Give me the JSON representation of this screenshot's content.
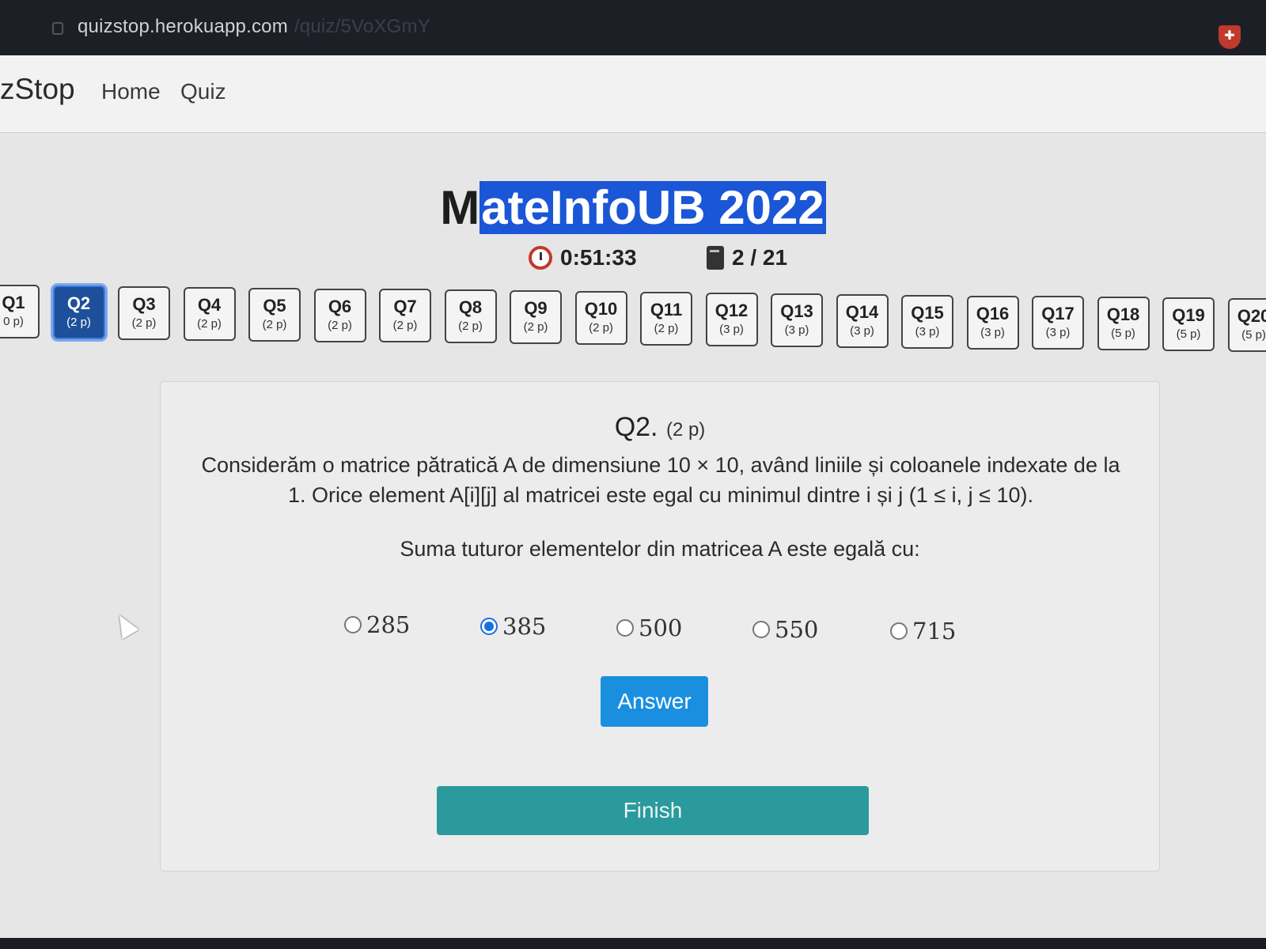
{
  "browser": {
    "url_host": "quizstop.herokuapp.com",
    "url_path": "/quiz/5VoXGmY"
  },
  "navbar": {
    "brand": "zStop",
    "links": [
      "Home",
      "Quiz"
    ]
  },
  "quiz": {
    "title_first": "M",
    "title_highlighted": "ateInfoUB 2022",
    "timer": "0:51:33",
    "progress": "2 / 21"
  },
  "question_nav": [
    {
      "label": "Q1",
      "points": "0 p)",
      "active": false
    },
    {
      "label": "Q2",
      "points": "(2 p)",
      "active": true
    },
    {
      "label": "Q3",
      "points": "(2 p)",
      "active": false
    },
    {
      "label": "Q4",
      "points": "(2 p)",
      "active": false
    },
    {
      "label": "Q5",
      "points": "(2 p)",
      "active": false
    },
    {
      "label": "Q6",
      "points": "(2 p)",
      "active": false
    },
    {
      "label": "Q7",
      "points": "(2 p)",
      "active": false
    },
    {
      "label": "Q8",
      "points": "(2 p)",
      "active": false
    },
    {
      "label": "Q9",
      "points": "(2 p)",
      "active": false
    },
    {
      "label": "Q10",
      "points": "(2 p)",
      "active": false
    },
    {
      "label": "Q11",
      "points": "(2 p)",
      "active": false
    },
    {
      "label": "Q12",
      "points": "(3 p)",
      "active": false
    },
    {
      "label": "Q13",
      "points": "(3 p)",
      "active": false
    },
    {
      "label": "Q14",
      "points": "(3 p)",
      "active": false
    },
    {
      "label": "Q15",
      "points": "(3 p)",
      "active": false
    },
    {
      "label": "Q16",
      "points": "(3 p)",
      "active": false
    },
    {
      "label": "Q17",
      "points": "(3 p)",
      "active": false
    },
    {
      "label": "Q18",
      "points": "(5 p)",
      "active": false
    },
    {
      "label": "Q19",
      "points": "(5 p)",
      "active": false
    },
    {
      "label": "Q20",
      "points": "(5 p)",
      "active": false
    }
  ],
  "question": {
    "number": "Q2.",
    "points": "(2 p)",
    "text_line1": "Considerăm o matrice pătratică A de dimensiune 10 × 10, având liniile și coloanele indexate de la",
    "text_line2": "1. Orice element A[i][j] al matricei este egal cu minimul dintre i și j (1 ≤ i, j ≤ 10).",
    "prompt": "Suma tuturor elementelor din matricea A este egală cu:",
    "options": [
      {
        "value": "285",
        "selected": false
      },
      {
        "value": "385",
        "selected": true
      },
      {
        "value": "500",
        "selected": false
      },
      {
        "value": "550",
        "selected": false
      },
      {
        "value": "715",
        "selected": false
      }
    ]
  },
  "buttons": {
    "answer": "Answer",
    "finish": "Finish"
  },
  "colors": {
    "highlight": "#1a56d6",
    "active_question": "#1e4f9a",
    "answer_button": "#1a8fe0",
    "finish_button": "#2a9a9c"
  }
}
